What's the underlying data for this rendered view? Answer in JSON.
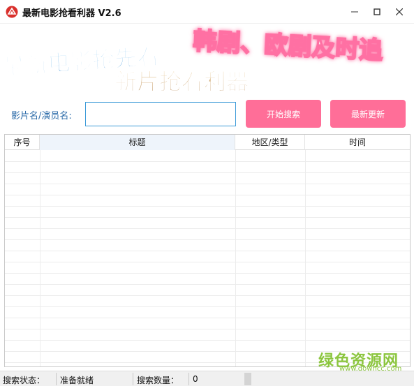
{
  "window": {
    "title": "最新电影抢看利器 V2.6",
    "icon": "app-logo-icon"
  },
  "banner": {
    "line1": "最新电影抢先看",
    "line2": "韩剧、欧剧及时追",
    "line3": "新片抢看利器",
    "colors": {
      "line1": "#2a8bd6",
      "line2": "#ff6fa3",
      "line3": "#b9864a"
    }
  },
  "search": {
    "label": "影片名/演员名:",
    "value": "",
    "placeholder": "",
    "start_button": "开始搜索",
    "latest_button": "最新更新",
    "button_color": "#ff6e98"
  },
  "table": {
    "columns": [
      "序号",
      "标题",
      "地区/类型",
      "时间"
    ],
    "rows": []
  },
  "status": {
    "state_label": "搜索状态：",
    "state_value": "准备就绪",
    "count_label": "搜索数量：",
    "count_value": "0"
  },
  "watermark": {
    "text": "绿色资源网",
    "url": "www.downcc.com"
  }
}
